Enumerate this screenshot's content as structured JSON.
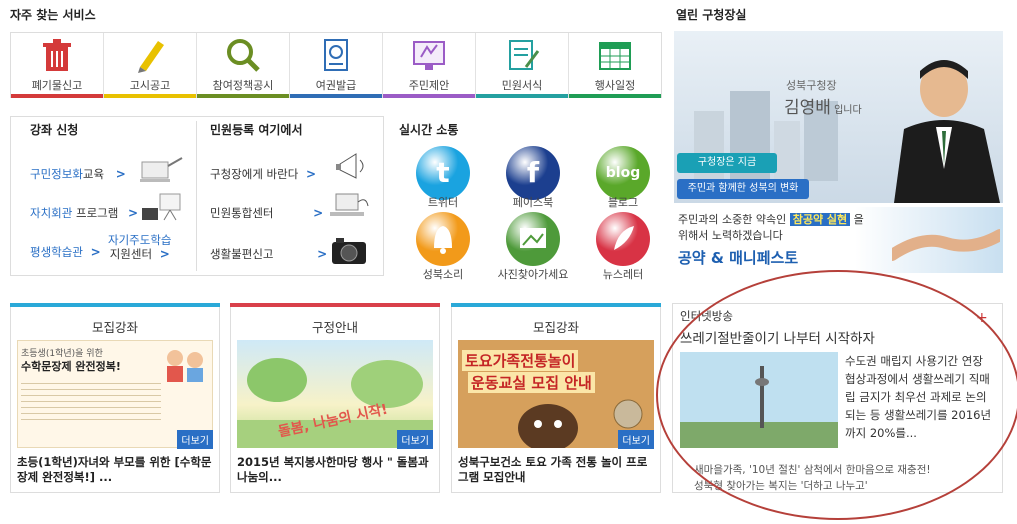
{
  "services": {
    "title": "자주 찾는 서비스",
    "items": [
      {
        "label": "폐기물신고",
        "icon": "trash-bin-icon",
        "color": "#d43a3a"
      },
      {
        "label": "고시공고",
        "icon": "pencil-icon",
        "color": "#e8c100"
      },
      {
        "label": "참여정책공시",
        "icon": "magnifier-icon",
        "color": "#6b8e23"
      },
      {
        "label": "여권발급",
        "icon": "passport-icon",
        "color": "#2f6db5"
      },
      {
        "label": "주민제안",
        "icon": "proposal-icon",
        "color": "#9b5cc6"
      },
      {
        "label": "민원서식",
        "icon": "form-icon",
        "color": "#24a0a0"
      },
      {
        "label": "행사일정",
        "icon": "calendar-icon",
        "color": "#1f9d55"
      }
    ]
  },
  "edu": {
    "title": "강좌 신청",
    "links": [
      {
        "hl": "구민정보화",
        "rest": "교육"
      },
      {
        "hl": "자치회관",
        "rest": " 프로그램"
      },
      {
        "hl": "평생학습관",
        "rest": ""
      }
    ],
    "self_study_line1": "자기주도학습",
    "self_study_line2": "지원센터",
    "arrow": ">"
  },
  "civil": {
    "title": "민원등록 여기에서",
    "links": [
      "구청장에게 바란다",
      "민원통합센터",
      "생활불편신고"
    ],
    "arrow": ">"
  },
  "realtime": {
    "title": "실시간 소통",
    "items": [
      {
        "label": "트위터",
        "glyph": "t",
        "color": "#1aa3e0"
      },
      {
        "label": "페이스북",
        "glyph": "f",
        "color": "#1c3f8f"
      },
      {
        "label": "블로그",
        "glyph": "blog",
        "color": "#5aa82a"
      },
      {
        "label": "성북소리",
        "glyph": "",
        "color": "#f29a1a"
      },
      {
        "label": "사진찾아가세요",
        "glyph": "",
        "color": "#4e9a3a"
      },
      {
        "label": "뉴스레터",
        "glyph": "",
        "color": "#d83345"
      }
    ]
  },
  "office": {
    "title": "열린 구청장실",
    "mayor_role": "성북구청장",
    "mayor_name": "김영배",
    "mayor_suffix": " 입니다",
    "btn1": "구청장은 지금",
    "btn2": "주민과 함께한 성북의 변화",
    "pledge_text1": "주민과의 소중한 약속인",
    "pledge_highlight": "참공약 실현",
    "pledge_text2": "을",
    "pledge_text3": "위해서 노력하겠습니다",
    "manifesto": "공약 & 매니페스토"
  },
  "cards": [
    {
      "title": "모집강좌",
      "color": "#2aa9d8",
      "more": "더보기",
      "poster_line1": "초등생(1학년)을 위한",
      "poster_line2": "수학문장제 완전정복!",
      "caption": "초등(1학년)자녀와 부모를 위한 [수학문장제 완전정복!] ..."
    },
    {
      "title": "구정안내",
      "color": "#d9404a",
      "more": "더보기",
      "poster_line1": "돌봄, 나눔의 시작!",
      "poster_line2": "",
      "caption": "2015년 복지봉사한마당 행사 \" 돌봄과 나눔의..."
    },
    {
      "title": "모집강좌",
      "color": "#2aa9d8",
      "more": "더보기",
      "poster_line1": "토요가족전통놀이",
      "poster_line2": "운동교실 모집 안내",
      "caption": "성북구보건소 토요 가족 전통 놀이 프로그램 모집안내"
    }
  ],
  "internet": {
    "title": "인터넷방송",
    "headline": "쓰레기절반줄이기 나부터 시작하자",
    "body": "수도권 매립지 사용기간 연장 협상과정에서 생활쓰레기 직매립 금지가 최우선 과제로 논의되는 등 생활쓰레기를 2016년까지 20%를...",
    "more": "+",
    "news2": "새마을가족, '10년 절친' 삼척에서 한마음으로 재충전!",
    "news3": "성북형 찾아가는 복지는 '더하고 나누고'"
  }
}
